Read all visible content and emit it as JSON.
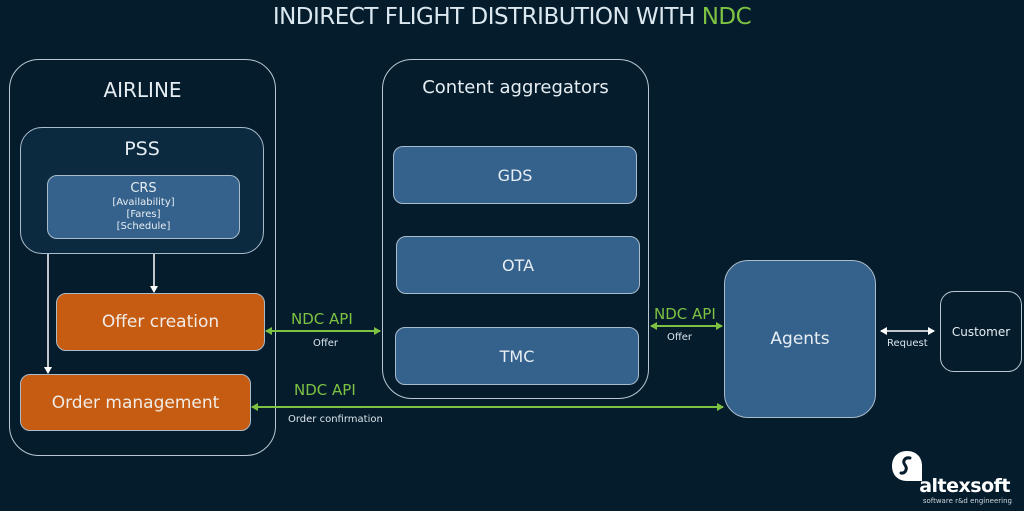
{
  "title": {
    "main": "INDIRECT FLIGHT DISTRIBUTION WITH ",
    "accent": "NDC",
    "accent_color": "#7dc242"
  },
  "airline": {
    "label": "AIRLINE",
    "pss": {
      "label": "PSS",
      "crs": {
        "title": "CRS",
        "lines": [
          "[Availability]",
          "[Fares]",
          "[Schedule]"
        ]
      }
    },
    "offer_creation": "Offer creation",
    "order_management": "Order management"
  },
  "aggregators": {
    "label": "Content aggregators",
    "items": [
      "GDS",
      "OTA",
      "TMC"
    ]
  },
  "agents": "Agents",
  "customer": "Customer",
  "connections": {
    "offer_api_left": {
      "api": "NDC API",
      "sub": "Offer"
    },
    "offer_api_right": {
      "api": "NDC API",
      "sub": "Offer"
    },
    "order_api": {
      "api": "NDC API",
      "sub": "Order confirmation"
    },
    "request": {
      "sub": "Request"
    }
  },
  "colors": {
    "background": "#041c2c",
    "node_blue": "#35628c",
    "node_orange": "#c65c12",
    "api_green": "#7dc242"
  },
  "logo": {
    "name": "altexsoft",
    "tagline": "software r&d engineering"
  }
}
